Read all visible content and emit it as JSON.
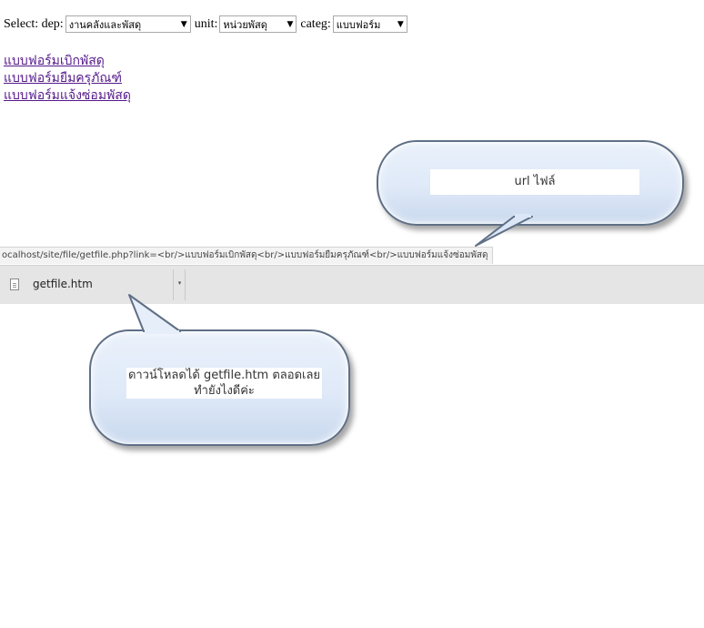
{
  "filters": {
    "dep_label": "Select: dep:",
    "dep_value": "งานคลังและพัสดุ",
    "unit_label": "unit:",
    "unit_value": "หน่วยพัสดุ",
    "categ_label": "categ:",
    "categ_value": "แบบฟอร์ม"
  },
  "links": [
    {
      "text": "แบบฟอร์มเบิกพัสดุ"
    },
    {
      "text": "แบบฟอร์มยืมครุภัณฑ์"
    },
    {
      "text": "แบบฟอร์มแจ้งซ่อมพัสดุ"
    }
  ],
  "status_url": "ocalhost/site/file/getfile.php?link=<br/>แบบฟอร์มเบิกพัสดุ<br/>แบบฟอร์มยืมครุภัณฑ์<br/>แบบฟอร์มแจ้งซ่อมพัสดุ",
  "download": {
    "filename": "getfile.htm",
    "menu_glyph": "▾"
  },
  "callouts": {
    "url_note": "url  ไฟล์",
    "download_note_line1": "ดาวน์โหลดได้ getfile.htm ตลอดเลย",
    "download_note_line2": "ทำยังไงดีค่ะ"
  },
  "icons": {
    "dropdown": "▼",
    "file": "file-icon"
  }
}
